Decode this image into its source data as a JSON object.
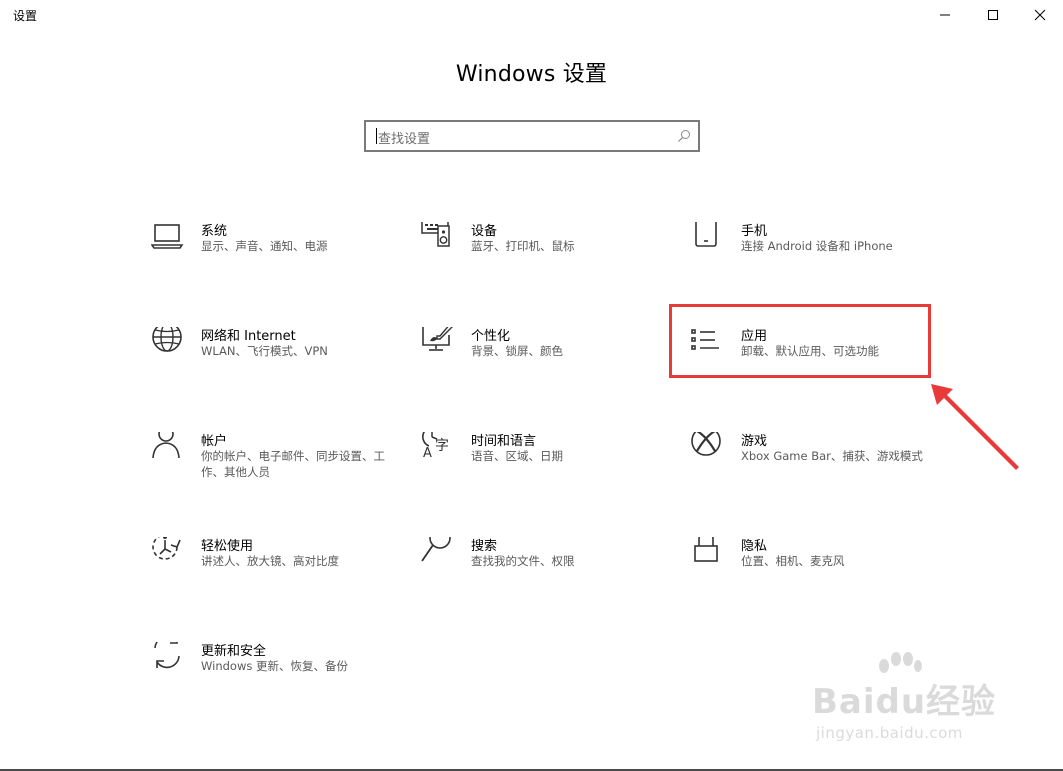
{
  "window": {
    "title": "设置",
    "controls": [
      "minimize-icon",
      "maximize-icon",
      "close-icon"
    ]
  },
  "header": {
    "title": "Windows 设置"
  },
  "search": {
    "placeholder": "查找设置",
    "icon": "search-icon"
  },
  "tiles": [
    {
      "name": "系统",
      "desc": "显示、声音、通知、电源",
      "icon": "laptop-icon"
    },
    {
      "name": "设备",
      "desc": "蓝牙、打印机、鼠标",
      "icon": "keyboard-speaker-icon"
    },
    {
      "name": "手机",
      "desc": "连接 Android 设备和 iPhone",
      "icon": "phone-icon"
    },
    {
      "name": "网络和 Internet",
      "desc": "WLAN、飞行模式、VPN",
      "icon": "globe-icon"
    },
    {
      "name": "个性化",
      "desc": "背景、锁屏、颜色",
      "icon": "paint-monitor-icon"
    },
    {
      "name": "应用",
      "desc": "卸载、默认应用、可选功能",
      "icon": "app-list-icon"
    },
    {
      "name": "帐户",
      "desc": "你的帐户、电子邮件、同步设置、工作、其他人员",
      "icon": "person-icon"
    },
    {
      "name": "时间和语言",
      "desc": "语音、区域、日期",
      "icon": "clock-language-icon"
    },
    {
      "name": "游戏",
      "desc": "Xbox Game Bar、捕获、游戏模式",
      "icon": "xbox-icon"
    },
    {
      "name": "轻松使用",
      "desc": "讲述人、放大镜、高对比度",
      "icon": "ease-of-access-icon"
    },
    {
      "name": "搜索",
      "desc": "查找我的文件、权限",
      "icon": "magnifier-icon"
    },
    {
      "name": "隐私",
      "desc": "位置、相机、麦克风",
      "icon": "lock-icon"
    },
    {
      "name": "更新和安全",
      "desc": "Windows 更新、恢复、备份",
      "icon": "sync-icon"
    }
  ],
  "annotation": {
    "highlighted_tile": "应用",
    "color": "#e93a3a"
  },
  "watermark": {
    "logo": "Baidu经验",
    "url": "jingyan.baidu.com"
  }
}
